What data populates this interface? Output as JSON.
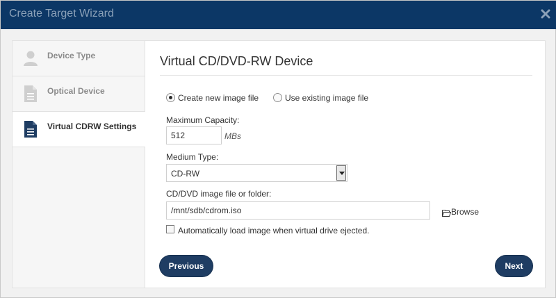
{
  "window": {
    "title": "Create Target Wizard",
    "close_icon": "close-icon"
  },
  "sidebar": {
    "items": [
      {
        "label": "Device Type",
        "icon": "user-icon",
        "active": false
      },
      {
        "label": "Optical Device",
        "icon": "document-icon",
        "active": false
      },
      {
        "label": "Virtual CDRW Settings",
        "icon": "document-icon",
        "active": true
      }
    ]
  },
  "main": {
    "heading": "Virtual CD/DVD-RW Device",
    "image_mode": {
      "create_new_label": "Create new image file",
      "use_existing_label": "Use existing image file",
      "selected": "create_new"
    },
    "capacity": {
      "label": "Maximum Capacity:",
      "value": "512",
      "unit": "MBs"
    },
    "medium_type": {
      "label": "Medium Type:",
      "selected": "CD-RW"
    },
    "image_path": {
      "label": "CD/DVD image file or folder:",
      "value": "/mnt/sdb/cdrom.iso",
      "browse_label": "Browse",
      "browse_icon": "folder-open-icon"
    },
    "auto_load": {
      "label": "Automatically load image when virtual drive ejected.",
      "checked": false
    }
  },
  "footer": {
    "previous_label": "Previous",
    "next_label": "Next"
  },
  "colors": {
    "titlebar": "#0c3766",
    "button": "#1f3d63",
    "active_icon": "#1f3d63",
    "inactive_icon": "#cfcfcf"
  }
}
